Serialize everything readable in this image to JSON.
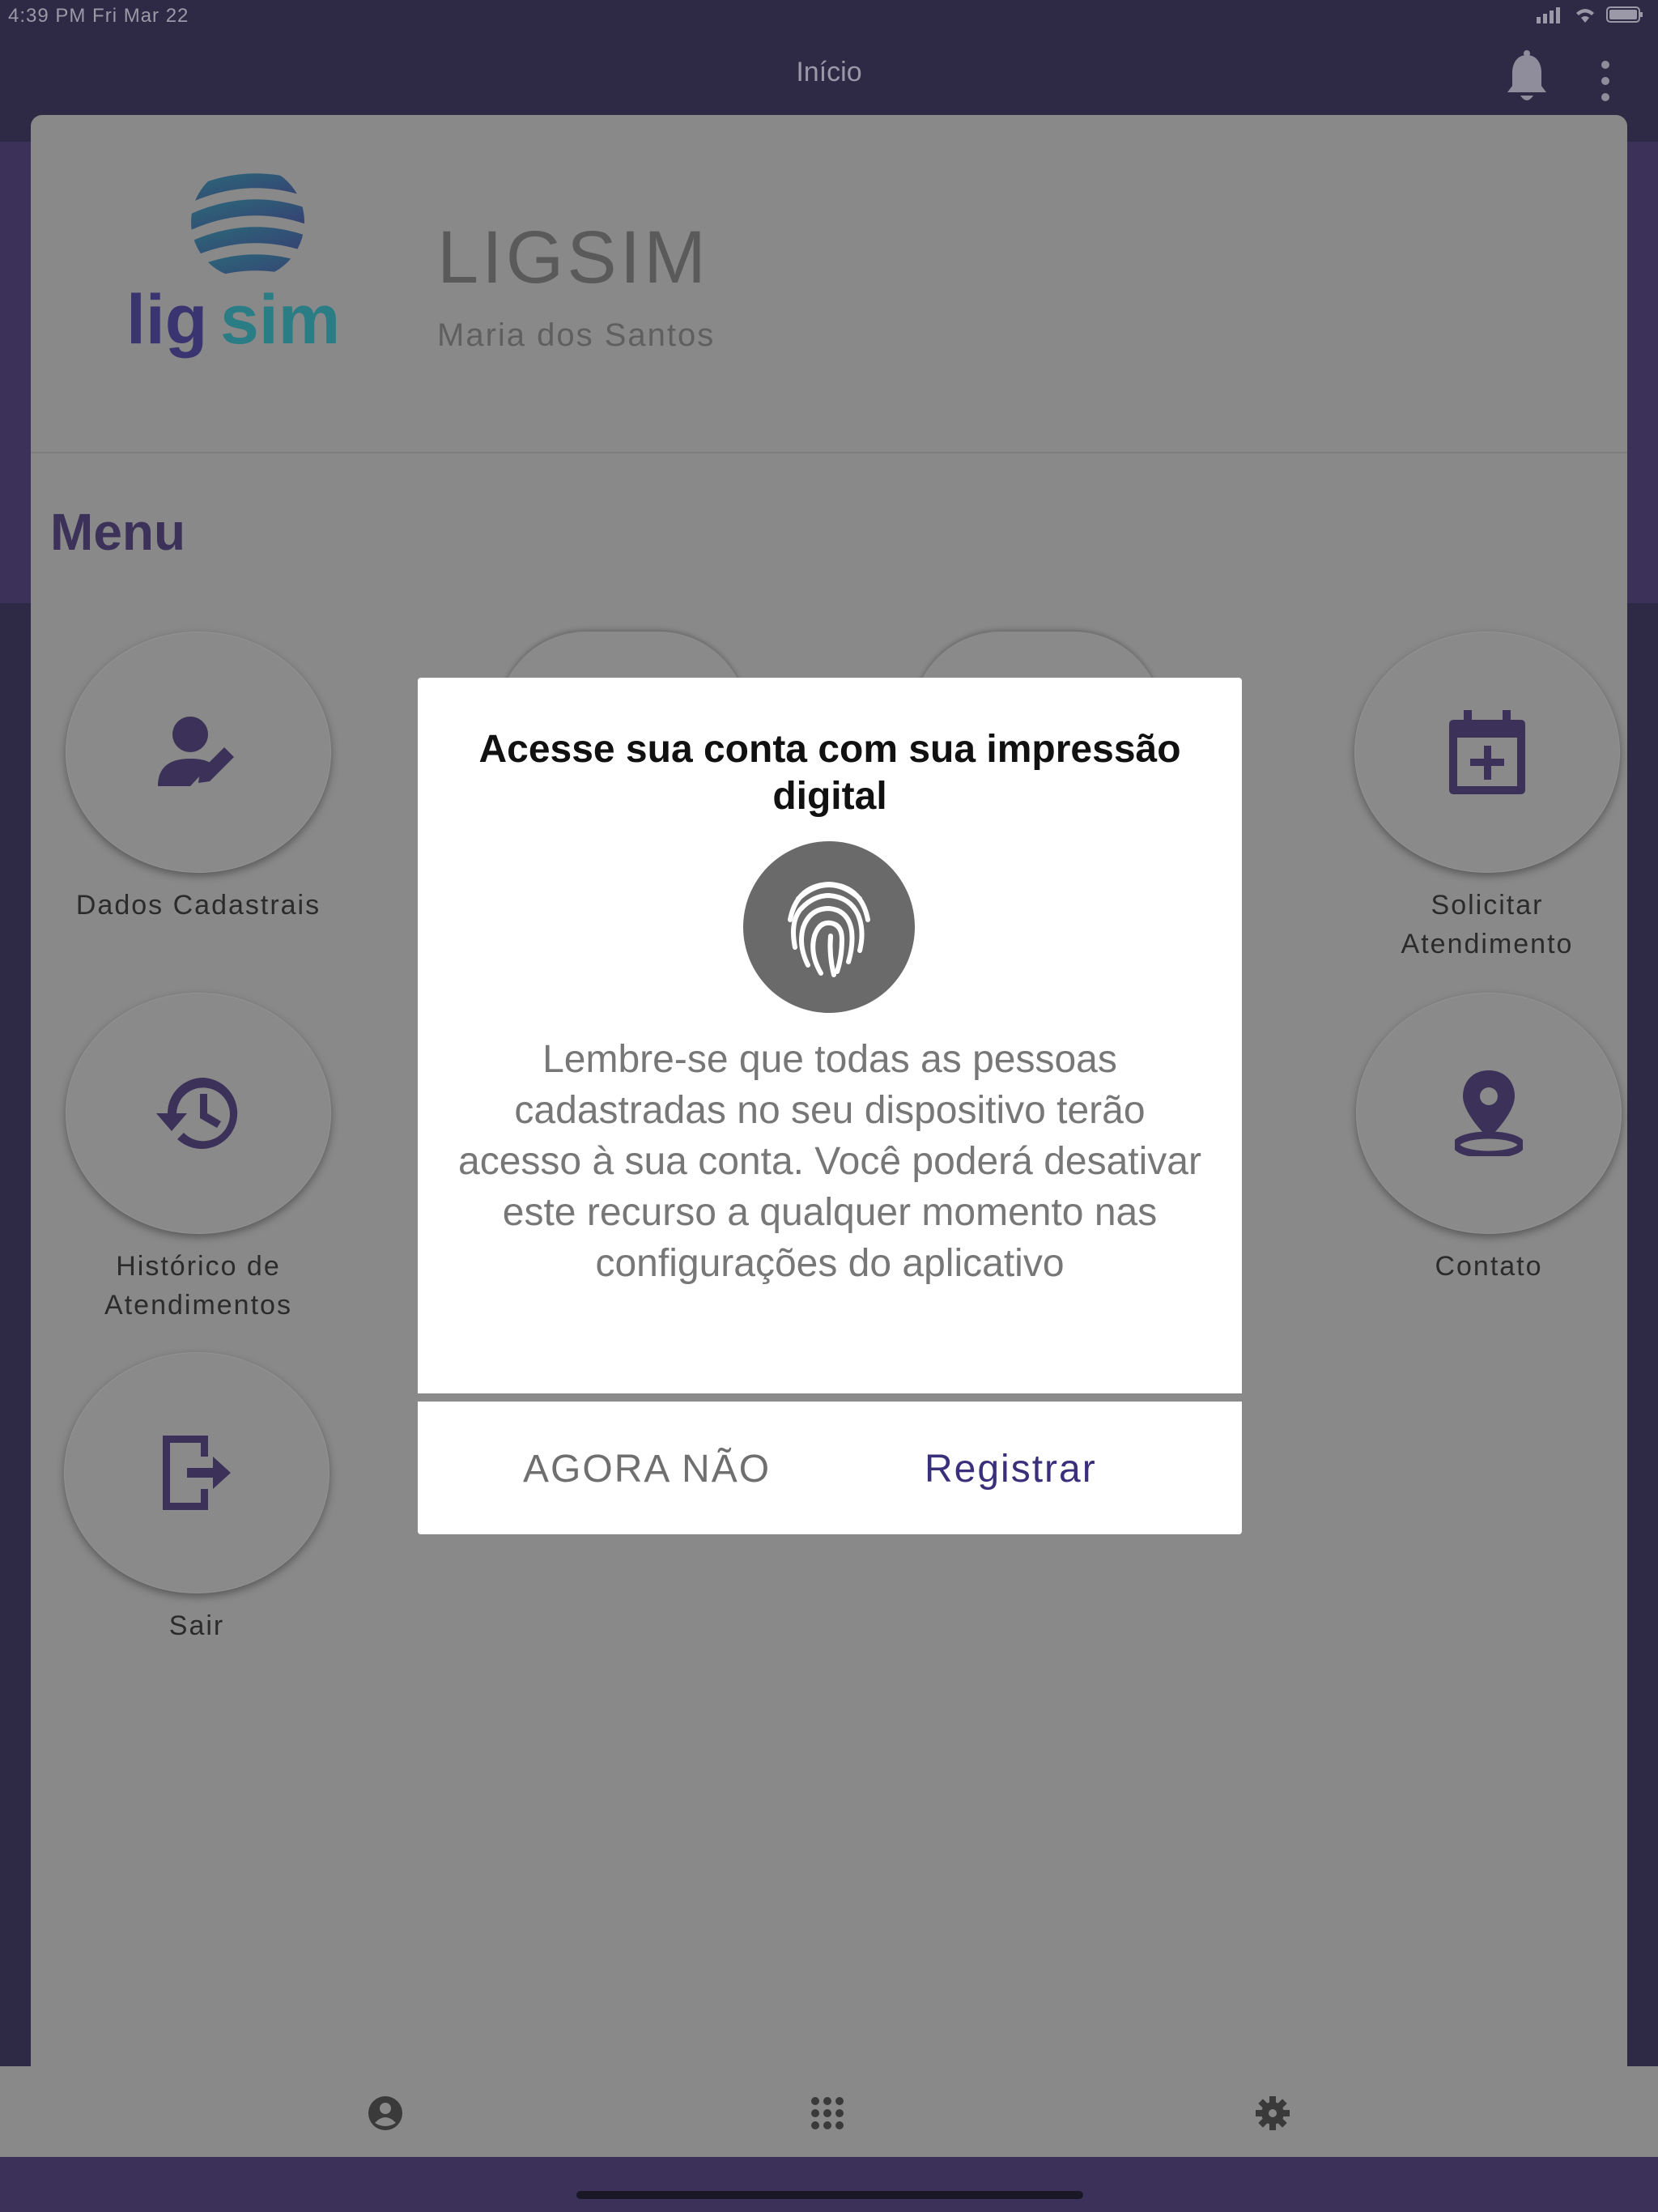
{
  "status_bar": {
    "time": "4:39 PM  Fri Mar 22"
  },
  "header": {
    "title": "Início"
  },
  "profile": {
    "brand": "LIGSIM",
    "user_name": "Maria dos Santos",
    "logo_text_a": "lig",
    "logo_text_b": "sim"
  },
  "menu": {
    "title": "Menu",
    "items": [
      {
        "label": "Dados Cadastrais",
        "icon": "user-edit-icon"
      },
      {
        "label": "Solicitar Atendimento",
        "icon": "calendar-add-icon"
      },
      {
        "label": "Histórico de Atendimentos",
        "icon": "history-icon"
      },
      {
        "label": "Contato",
        "icon": "location-pin-icon"
      },
      {
        "label": "Sair",
        "icon": "logout-icon"
      }
    ]
  },
  "dialog": {
    "title": "Acesse sua conta com sua impressão digital",
    "body": "Lembre-se que todas as pessoas cadastradas no seu dispositivo terão acesso à sua conta. Você poderá desativar este recurso a qualquer momento nas configurações do aplicativo",
    "cancel_label": "AGORA NÃO",
    "confirm_label": "Registrar"
  },
  "bottom_nav": {
    "items": [
      "profile-icon",
      "apps-grid-icon",
      "settings-icon"
    ]
  },
  "colors": {
    "primary": "#3b3159",
    "overlay": "#898989",
    "accent": "#3a2f7a"
  }
}
